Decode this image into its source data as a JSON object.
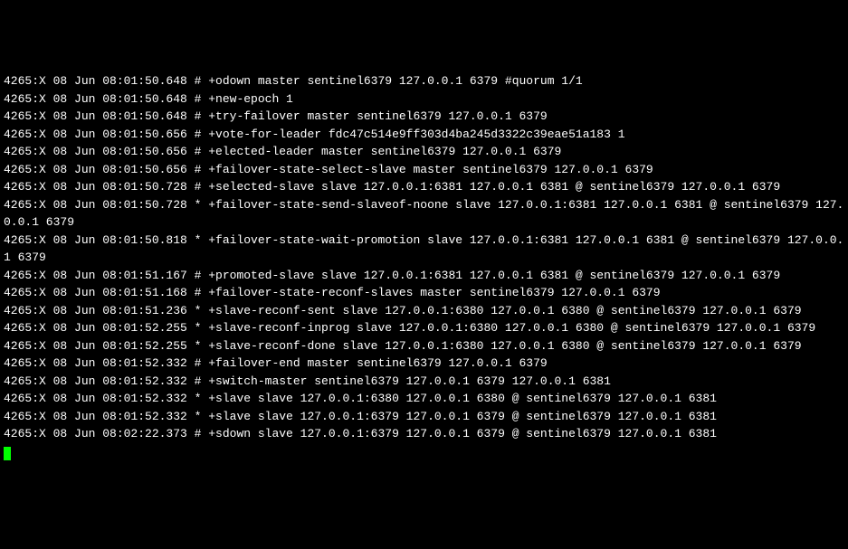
{
  "log_lines": [
    "4265:X 08 Jun 08:01:50.648 # +odown master sentinel6379 127.0.0.1 6379 #quorum 1/1",
    "4265:X 08 Jun 08:01:50.648 # +new-epoch 1",
    "4265:X 08 Jun 08:01:50.648 # +try-failover master sentinel6379 127.0.0.1 6379",
    "4265:X 08 Jun 08:01:50.656 # +vote-for-leader fdc47c514e9ff303d4ba245d3322c39eae51a183 1",
    "4265:X 08 Jun 08:01:50.656 # +elected-leader master sentinel6379 127.0.0.1 6379",
    "4265:X 08 Jun 08:01:50.656 # +failover-state-select-slave master sentinel6379 127.0.0.1 6379",
    "4265:X 08 Jun 08:01:50.728 # +selected-slave slave 127.0.0.1:6381 127.0.0.1 6381 @ sentinel6379 127.0.0.1 6379",
    "4265:X 08 Jun 08:01:50.728 * +failover-state-send-slaveof-noone slave 127.0.0.1:6381 127.0.0.1 6381 @ sentinel6379 127.0.0.1 6379",
    "4265:X 08 Jun 08:01:50.818 * +failover-state-wait-promotion slave 127.0.0.1:6381 127.0.0.1 6381 @ sentinel6379 127.0.0.1 6379",
    "4265:X 08 Jun 08:01:51.167 # +promoted-slave slave 127.0.0.1:6381 127.0.0.1 6381 @ sentinel6379 127.0.0.1 6379",
    "4265:X 08 Jun 08:01:51.168 # +failover-state-reconf-slaves master sentinel6379 127.0.0.1 6379",
    "4265:X 08 Jun 08:01:51.236 * +slave-reconf-sent slave 127.0.0.1:6380 127.0.0.1 6380 @ sentinel6379 127.0.0.1 6379",
    "4265:X 08 Jun 08:01:52.255 * +slave-reconf-inprog slave 127.0.0.1:6380 127.0.0.1 6380 @ sentinel6379 127.0.0.1 6379",
    "4265:X 08 Jun 08:01:52.255 * +slave-reconf-done slave 127.0.0.1:6380 127.0.0.1 6380 @ sentinel6379 127.0.0.1 6379",
    "4265:X 08 Jun 08:01:52.332 # +failover-end master sentinel6379 127.0.0.1 6379",
    "4265:X 08 Jun 08:01:52.332 # +switch-master sentinel6379 127.0.0.1 6379 127.0.0.1 6381",
    "4265:X 08 Jun 08:01:52.332 * +slave slave 127.0.0.1:6380 127.0.0.1 6380 @ sentinel6379 127.0.0.1 6381",
    "4265:X 08 Jun 08:01:52.332 * +slave slave 127.0.0.1:6379 127.0.0.1 6379 @ sentinel6379 127.0.0.1 6381",
    "4265:X 08 Jun 08:02:22.373 # +sdown slave 127.0.0.1:6379 127.0.0.1 6379 @ sentinel6379 127.0.0.1 6381"
  ]
}
